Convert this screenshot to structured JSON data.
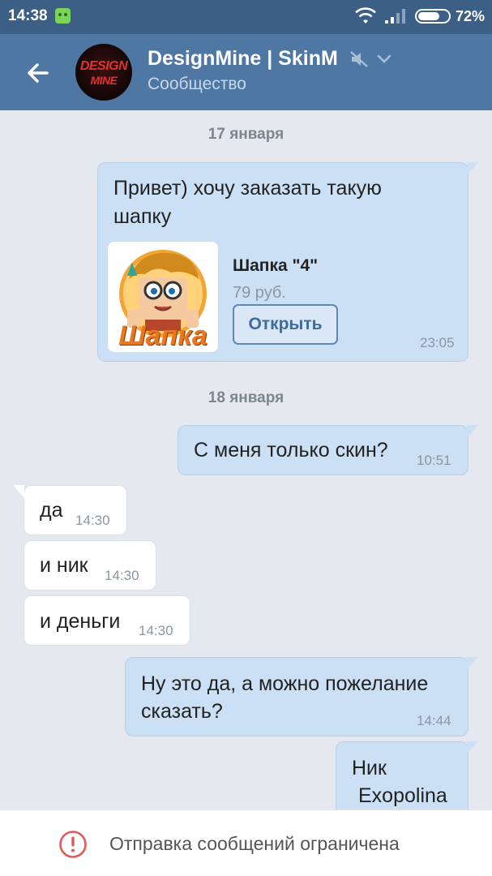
{
  "status_bar": {
    "time": "14:38",
    "battery_percent_text": "72%",
    "battery_level": 0.72,
    "icons": [
      "notification-app-icon",
      "wifi-icon",
      "signal-icon",
      "battery-icon"
    ]
  },
  "header": {
    "back_icon": "arrow-left-icon",
    "avatar_text_line1": "DESIGN",
    "avatar_text_line2": "MINE",
    "title": "DesignMine | SkinM",
    "subtitle": "Сообщество",
    "mute_icon": "muted-speaker-icon",
    "dropdown_icon": "chevron-down-icon"
  },
  "chat": {
    "date_1": "17 января",
    "msg_1_text_line1": "Привет) хочу заказать такую",
    "msg_1_text_line2": "шапку",
    "msg_1_time": "23:05",
    "attachment": {
      "thumb_label": "Шапка",
      "title": "Шапка \"4\"",
      "price": "79 руб.",
      "button_label": "Открыть"
    },
    "date_2": "18 января",
    "msg_2_text": "С меня только скин?",
    "msg_2_time": "10:51",
    "msg_3_text": "да",
    "msg_3_time": "14:30",
    "msg_4_text": "и ник",
    "msg_4_time": "14:30",
    "msg_5_text": "и деньги",
    "msg_5_time": "14:30",
    "msg_6_text_line1": "Ну это да, а можно пожелание",
    "msg_6_text_line2": "сказать?",
    "msg_6_time": "14:44",
    "msg_7_text_line1": "Ник",
    "msg_7_text_line2": "Exopolina"
  },
  "bottom": {
    "warning_icon": "exclamation-circle-icon",
    "text": "Отправка сообщений ограничена"
  },
  "colors": {
    "header": "#4f77a4",
    "status_bar": "#3c5f86",
    "outgoing_bubble": "#cce0f5",
    "incoming_bubble": "#ffffff",
    "background": "#e5e9ef",
    "warning_red": "#e05a5a"
  }
}
